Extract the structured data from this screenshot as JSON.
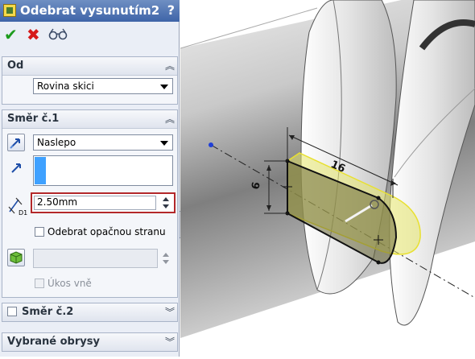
{
  "panel": {
    "title": "Odebrat vysunutím2",
    "help_label": "?",
    "toolbar": {
      "ok_icon": "checkmark-icon",
      "cancel_icon": "x-icon",
      "preview_icon": "glasses-icon"
    }
  },
  "from_group": {
    "title": "Od",
    "select_value": "Rovina skici"
  },
  "direction1_group": {
    "title": "Směr č.1",
    "end_condition": "Naslepo",
    "depth_value": "2.50mm",
    "depth_icon_label": "D1",
    "reverse_side_label": "Odebrat opačnou stranu",
    "draft_outward_label": "Úkos vně"
  },
  "direction2_group": {
    "title": "Směr č.2"
  },
  "selected_contours_group": {
    "title": "Vybrané obrysy"
  },
  "viewport": {
    "dimension_length": "16",
    "dimension_height": "6",
    "accent_color": "#f0e84a"
  }
}
